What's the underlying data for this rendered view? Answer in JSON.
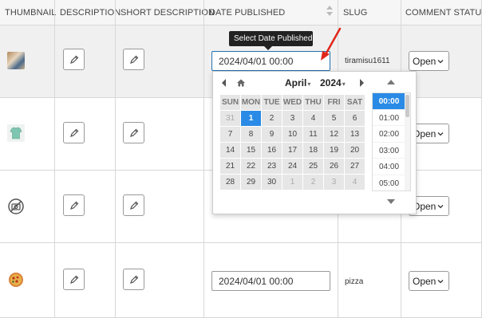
{
  "headers": {
    "thumbnail": "THUMBNAIL",
    "description": "DESCRIPTION",
    "short_description": "SHORT DESCRIPTION",
    "date_published": "DATE PUBLISHED",
    "slug": "SLUG",
    "comment_status": "COMMENT STATUS"
  },
  "rows": [
    {
      "date": "2024/04/01 00:00",
      "slug": "tiramisu1611",
      "comment_status": "Open",
      "thumb_icon": "dessert-thumbnail"
    },
    {
      "date": "",
      "slug": "",
      "comment_status": "Open",
      "thumb_icon": "tshirt-thumbnail"
    },
    {
      "date": "",
      "slug": "",
      "comment_status": "Open",
      "thumb_icon": "no-image-icon"
    },
    {
      "date": "2024/04/01 00:00",
      "slug": "pizza",
      "comment_status": "Open",
      "thumb_icon": "pizza-thumbnail"
    }
  ],
  "tooltip": "Select Date Published",
  "picker": {
    "month": "April",
    "year": "2024",
    "weekdays": [
      "SUN",
      "MON",
      "TUE",
      "WED",
      "THU",
      "FRI",
      "SAT"
    ],
    "weeks": [
      [
        "31",
        "1",
        "2",
        "3",
        "4",
        "5",
        "6"
      ],
      [
        "7",
        "8",
        "9",
        "10",
        "11",
        "12",
        "13"
      ],
      [
        "14",
        "15",
        "16",
        "17",
        "18",
        "19",
        "20"
      ],
      [
        "21",
        "22",
        "23",
        "24",
        "25",
        "26",
        "27"
      ],
      [
        "28",
        "29",
        "30",
        "1",
        "2",
        "3",
        "4"
      ]
    ],
    "selected_day": "1",
    "times": [
      "00:00",
      "01:00",
      "02:00",
      "03:00",
      "04:00",
      "05:00"
    ],
    "selected_time": "00:00"
  },
  "colors": {
    "accent": "#2a8be6",
    "annotation_arrow": "#e0261b"
  }
}
